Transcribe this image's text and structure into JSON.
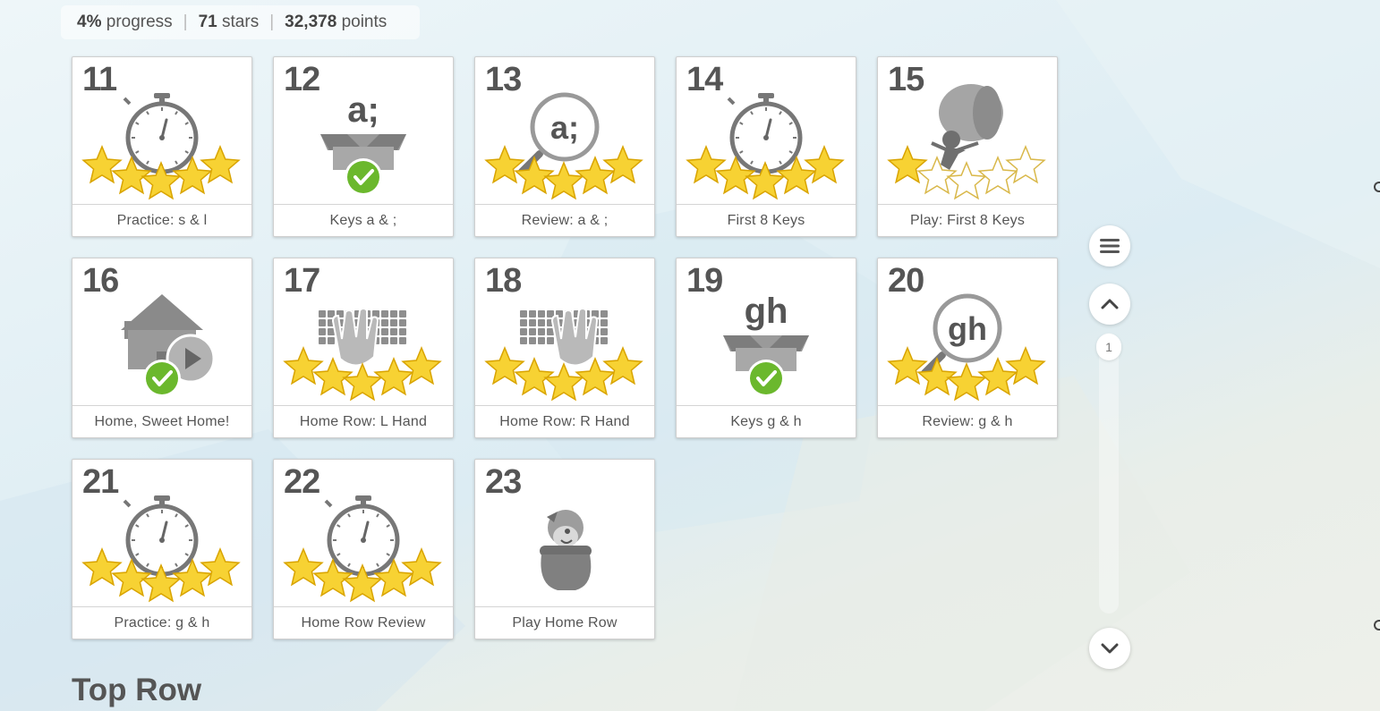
{
  "stats": {
    "progress_value": "4%",
    "progress_label": "progress",
    "stars_value": "71",
    "stars_label": "stars",
    "points_value": "32,378",
    "points_label": "points",
    "separator": "|"
  },
  "lessons": [
    {
      "number": "11",
      "label": "Practice: s & l",
      "icon": "stopwatch-icon",
      "stars": 5,
      "complete": false
    },
    {
      "number": "12",
      "label": "Keys a & ;",
      "icon": "open-box-icon",
      "box_text": "a;",
      "stars": 0,
      "complete": true
    },
    {
      "number": "13",
      "label": "Review: a & ;",
      "icon": "magnifier-icon",
      "lens_text": "a;",
      "stars": 5,
      "complete": false
    },
    {
      "number": "14",
      "label": "First 8 Keys",
      "icon": "stopwatch-icon",
      "stars": 5,
      "complete": false
    },
    {
      "number": "15",
      "label": "Play: First 8 Keys",
      "icon": "balloon-game-icon",
      "stars": 1,
      "complete": false
    },
    {
      "number": "16",
      "label": "Home, Sweet Home!",
      "icon": "house-video-icon",
      "stars": 0,
      "complete": true
    },
    {
      "number": "17",
      "label": "Home Row: L Hand",
      "icon": "keyboard-left-hand-icon",
      "stars": 5,
      "complete": false
    },
    {
      "number": "18",
      "label": "Home Row: R Hand",
      "icon": "keyboard-right-hand-icon",
      "stars": 5,
      "complete": false
    },
    {
      "number": "19",
      "label": "Keys g & h",
      "icon": "open-box-icon",
      "box_text": "gh",
      "stars": 0,
      "complete": true
    },
    {
      "number": "20",
      "label": "Review: g & h",
      "icon": "magnifier-icon",
      "lens_text": "gh",
      "stars": 5,
      "complete": false
    },
    {
      "number": "21",
      "label": "Practice: g & h",
      "icon": "stopwatch-icon",
      "stars": 5,
      "complete": false
    },
    {
      "number": "22",
      "label": "Home Row Review",
      "icon": "stopwatch-icon",
      "stars": 5,
      "complete": false
    },
    {
      "number": "23",
      "label": "Play Home Row",
      "icon": "pot-creature-game-icon",
      "stars": 0,
      "complete": false
    }
  ],
  "sidebar": {
    "menu_icon": "hamburger-icon",
    "up_icon": "chevron-up-icon",
    "down_icon": "chevron-down-icon",
    "page_indicator": "1"
  },
  "next_section_title": "Top Row",
  "colors": {
    "star_fill": "#f7d233",
    "star_outline": "#d9a400",
    "icon_gray": "#8f8f8f",
    "check_green": "#6bb82d"
  }
}
